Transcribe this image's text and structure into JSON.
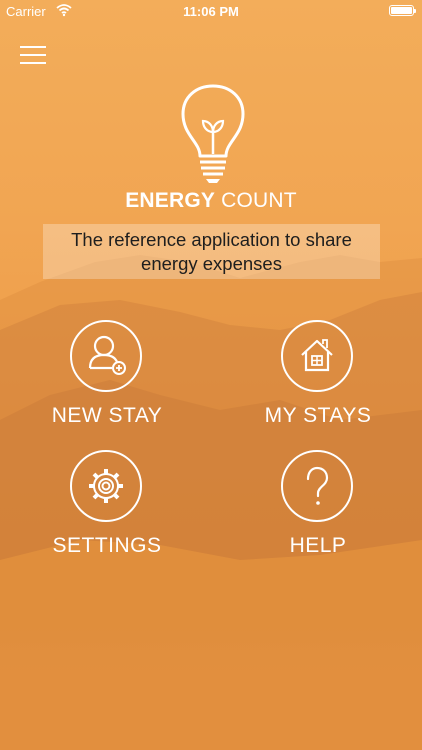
{
  "status_bar": {
    "carrier": "Carrier",
    "time": "11:06 PM"
  },
  "brand": {
    "name_bold": "ENERGY",
    "name_light": "COUNT"
  },
  "tagline": "The reference application to share energy expenses",
  "menu": {
    "new_stay": {
      "label": "NEW STAY",
      "icon": "add-user-icon"
    },
    "my_stays": {
      "label": "MY STAYS",
      "icon": "house-icon"
    },
    "settings": {
      "label": "SETTINGS",
      "icon": "gear-icon"
    },
    "help": {
      "label": "HELP",
      "icon": "question-mark-icon"
    }
  },
  "colors": {
    "background": "#f1a552",
    "foreground": "#ffffff",
    "tagline_text": "#1e1e1e"
  }
}
